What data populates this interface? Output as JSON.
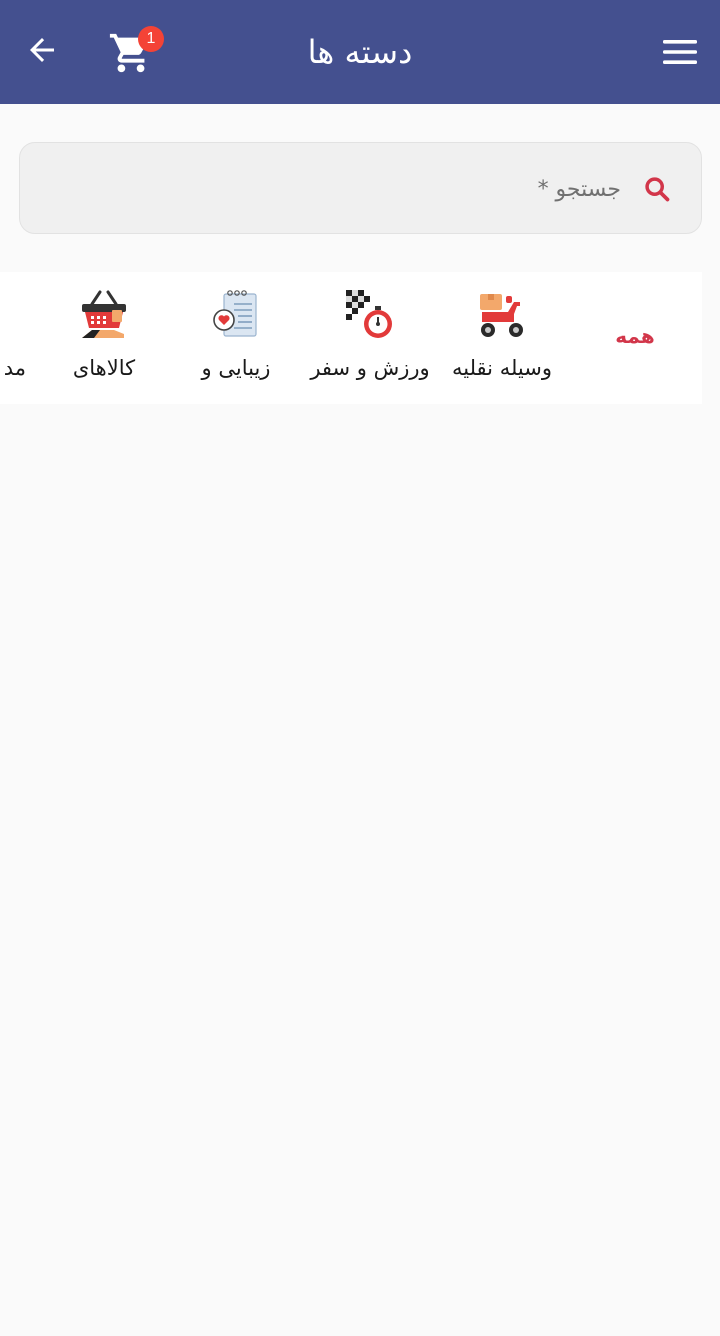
{
  "header": {
    "title": "دسته ها",
    "cart_count": "1",
    "back_icon": "arrow-left-icon",
    "cart_icon": "shopping-cart-icon",
    "menu_icon": "hamburger-menu-icon",
    "background_color": "#44508f",
    "badge_color": "#f44336"
  },
  "search": {
    "placeholder": "جستجو *",
    "icon": "search-icon",
    "icon_color": "#d2364a"
  },
  "categories": {
    "all_label": "همه",
    "accent_color": "#d2364a",
    "items": [
      {
        "label": "وسیله نقلیه",
        "icon": "delivery-scooter-icon"
      },
      {
        "label": "ورزش و سفر",
        "icon": "checkered-flag-stopwatch-icon"
      },
      {
        "label": "زیبایی و",
        "icon": "notepad-heart-icon"
      },
      {
        "label": "کالاهای",
        "icon": "shopping-basket-icon"
      },
      {
        "label": "مد",
        "icon": ""
      }
    ]
  }
}
